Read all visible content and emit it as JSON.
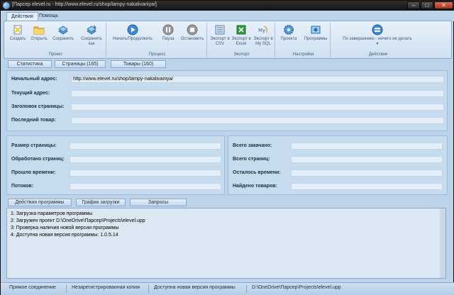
{
  "window": {
    "title": "[Парсер elevel.ru - http://www.elevel.ru/shop/lampy-nakalivaniya/]",
    "minimize": "–",
    "maximize": "□",
    "close": "✕"
  },
  "ribbon_tabs": [
    "Действия",
    "Помощь"
  ],
  "ribbon": {
    "groups": [
      {
        "label": "Проект",
        "buttons": [
          "Создать",
          "Открыть",
          "Сохранить",
          "Сохранить как"
        ]
      },
      {
        "label": "Процесс",
        "buttons": [
          "Начать/Продолжить",
          "Пауза",
          "Остановить"
        ]
      },
      {
        "label": "Экспорт",
        "buttons": [
          "Экспорт в CSV",
          "Экспорт в Excel",
          "Экспорт в My SQL"
        ]
      },
      {
        "label": "Настройки",
        "buttons": [
          "Проекта",
          "Программы"
        ]
      },
      {
        "label": "Действия",
        "buttons": [
          "По завершению - ничего не делать"
        ]
      }
    ],
    "colors": {
      "green": "#2f9e3a",
      "blue": "#2a6fb0",
      "gray": "#8c8c8c"
    }
  },
  "top_tabs": [
    "Статистика",
    "Страницы (165)",
    "Товары (160)"
  ],
  "info": {
    "start_address_label": "Начальный адрес:",
    "start_address_value": "http://www.elevel.ru/shop/lampy-nakalivaniya/",
    "current_address_label": "Текущий адрес:",
    "page_title_label": "Заголовок страницы:",
    "last_item_label": "Последний товар:"
  },
  "stats_left": {
    "page_size_label": "Размер страницы:",
    "processed_label": "Обработано страниц:",
    "elapsed_label": "Прошло времени:",
    "threads_label": "Потоков:"
  },
  "stats_right": {
    "downloaded_label": "Всего закачано:",
    "total_pages_label": "Всего страниц:",
    "remaining_label": "Осталось времени:",
    "found_label": "Найдено товаров:"
  },
  "bottom_tabs": [
    "Действия программы",
    "График загрузки",
    "Запросы"
  ],
  "log": [
    "1: Загрузка параметров программы",
    "2: Загружен проект D:\\OneDrive\\Парсер\\Projects\\elevel.upp",
    "3: Проверка наличия новой версии программы",
    "4: Доступна новая версия программы: 1.0.5.14"
  ],
  "status": {
    "connection": "Прямое соединение",
    "license": "Незарегистрированная копия",
    "update": "Доступна новая версия программы",
    "project_path": "D:\\OneDrive\\Парсер\\Projects\\elevel.upp"
  }
}
